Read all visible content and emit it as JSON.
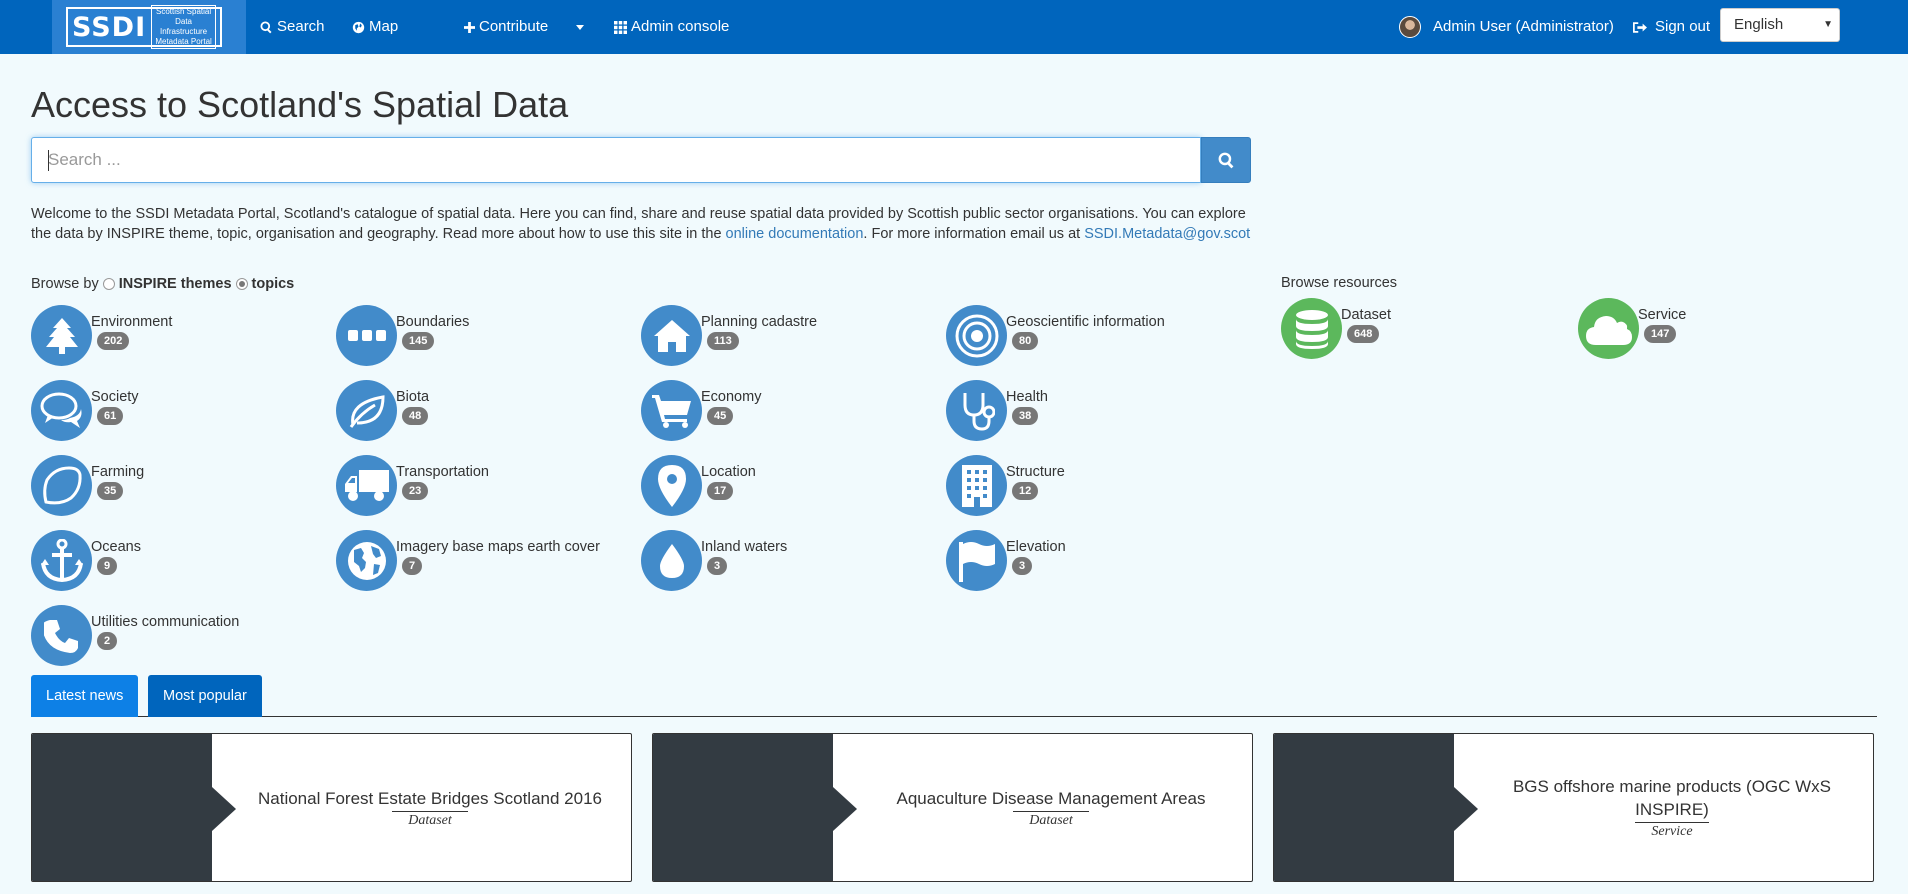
{
  "brand": {
    "logo_main": "SSDI",
    "logo_sub_lines": [
      "Scottish Spatial",
      "Data Infrastructure",
      "Metadata Portal"
    ]
  },
  "nav": {
    "search": "Search",
    "map": "Map",
    "contribute": "Contribute",
    "admin_console": "Admin console",
    "user": "Admin User (Administrator)",
    "sign_out": "Sign out",
    "language": "English"
  },
  "page_title": "Access to Scotland's Spatial Data",
  "search": {
    "placeholder": "Search ..."
  },
  "intro": {
    "text_1": "Welcome to the SSDI Metadata Portal, Scotland's catalogue of spatial data. Here you can find, share and reuse spatial data provided by Scottish public sector organisations. You can explore the data by INSPIRE theme, topic, organisation and geography. Read more about how to use this site in the ",
    "link_docs": "online documentation",
    "text_2": ". For more information email us at ",
    "link_email": "SSDI.Metadata@gov.scot"
  },
  "browse_by": {
    "label": "Browse by",
    "option_1": "INSPIRE themes",
    "option_2": "topics",
    "selected": "topics"
  },
  "topics": [
    {
      "label": "Environment",
      "count": "202",
      "icon": "tree-icon"
    },
    {
      "label": "Boundaries",
      "count": "145",
      "icon": "ellipsis-icon"
    },
    {
      "label": "Planning cadastre",
      "count": "113",
      "icon": "home-icon"
    },
    {
      "label": "Geoscientific information",
      "count": "80",
      "icon": "target-icon"
    },
    {
      "label": "Society",
      "count": "61",
      "icon": "comments-icon"
    },
    {
      "label": "Biota",
      "count": "48",
      "icon": "leaf-icon"
    },
    {
      "label": "Economy",
      "count": "45",
      "icon": "cart-icon"
    },
    {
      "label": "Health",
      "count": "38",
      "icon": "stethoscope-icon"
    },
    {
      "label": "Farming",
      "count": "35",
      "icon": "lemon-icon"
    },
    {
      "label": "Transportation",
      "count": "23",
      "icon": "truck-icon"
    },
    {
      "label": "Location",
      "count": "17",
      "icon": "map-marker-icon"
    },
    {
      "label": "Structure",
      "count": "12",
      "icon": "building-icon"
    },
    {
      "label": "Oceans",
      "count": "9",
      "icon": "anchor-icon"
    },
    {
      "label": "Imagery base maps earth cover",
      "count": "7",
      "icon": "globe-icon"
    },
    {
      "label": "Inland waters",
      "count": "3",
      "icon": "tint-icon"
    },
    {
      "label": "Elevation",
      "count": "3",
      "icon": "flag-icon"
    },
    {
      "label": "Utilities communication",
      "count": "2",
      "icon": "phone-icon"
    }
  ],
  "browse_resources": {
    "label": "Browse resources",
    "items": [
      {
        "label": "Dataset",
        "count": "648",
        "icon": "database-icon"
      },
      {
        "label": "Service",
        "count": "147",
        "icon": "cloud-icon"
      }
    ]
  },
  "tabs": {
    "latest_news": "Latest news",
    "most_popular": "Most popular"
  },
  "cards": [
    {
      "title": "National Forest Estate Bridges Scotland 2016",
      "type": "Dataset"
    },
    {
      "title": "Aquaculture Disease Management Areas",
      "type": "Dataset"
    },
    {
      "title": "BGS offshore marine products (OGC WxS INSPIRE)",
      "type": "Service"
    }
  ],
  "colors": {
    "nav": "#0065bd",
    "accent": "#428bca",
    "resource": "#5cb85c",
    "background": "#f1fafd"
  }
}
